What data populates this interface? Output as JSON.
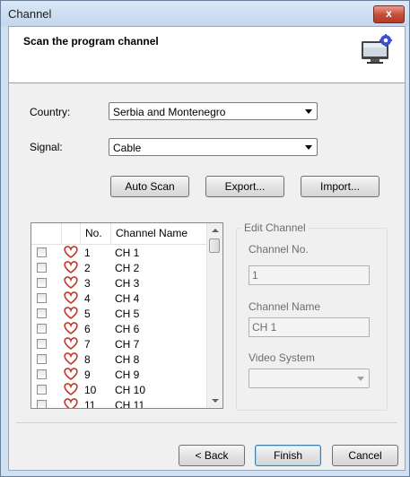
{
  "window": {
    "title": "Channel",
    "close_label": "x"
  },
  "header": {
    "title": "Scan the program channel",
    "icon": "monitor-settings-icon"
  },
  "form": {
    "country_label": "Country:",
    "country_value": "Serbia and Montenegro",
    "signal_label": "Signal:",
    "signal_value": "Cable"
  },
  "buttons": {
    "auto_scan": "Auto Scan",
    "export": "Export...",
    "import": "Import...",
    "back": "< Back",
    "finish": "Finish",
    "cancel": "Cancel"
  },
  "list": {
    "columns": [
      "",
      "No.",
      "Channel Name"
    ],
    "rows": [
      {
        "no": "1",
        "name": "CH 1"
      },
      {
        "no": "2",
        "name": "CH 2"
      },
      {
        "no": "3",
        "name": "CH 3"
      },
      {
        "no": "4",
        "name": "CH 4"
      },
      {
        "no": "5",
        "name": "CH 5"
      },
      {
        "no": "6",
        "name": "CH 6"
      },
      {
        "no": "7",
        "name": "CH 7"
      },
      {
        "no": "8",
        "name": "CH 8"
      },
      {
        "no": "9",
        "name": "CH 9"
      },
      {
        "no": "10",
        "name": "CH 10"
      },
      {
        "no": "11",
        "name": "CH 11"
      }
    ]
  },
  "edit_channel": {
    "title": "Edit Channel",
    "channel_no_label": "Channel No.",
    "channel_no_value": "1",
    "channel_name_label": "Channel Name",
    "channel_name_value": "CH 1",
    "video_system_label": "Video System",
    "video_system_value": ""
  },
  "colors": {
    "heart": "#c0392b",
    "title_bar": "#c3d7ee",
    "close_button": "#c44b34"
  }
}
